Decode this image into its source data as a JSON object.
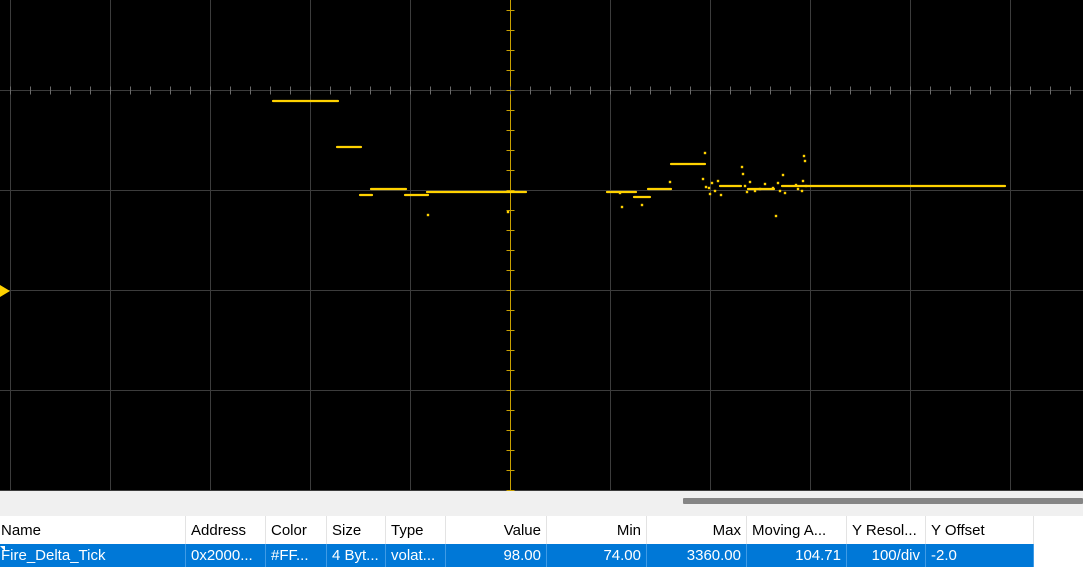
{
  "colors": {
    "background": "#000000",
    "grid": "#3c3c3c",
    "trace": "#ffd200",
    "cursor": "#c8a000",
    "selection": "#0078d7"
  },
  "icons": {
    "channel_marker": "triangle-right-icon"
  },
  "chart_data": {
    "type": "scatter",
    "grid": true,
    "xlim": [
      0,
      10.83
    ],
    "ylim": [
      -2.0,
      2.91
    ],
    "trigger_level": 0,
    "series": [
      {
        "segments": [
          [
            2.73,
            3.38,
            1.9
          ],
          [
            3.37,
            3.61,
            1.44
          ],
          [
            3.6,
            3.72,
            0.96
          ],
          [
            3.71,
            4.06,
            1.02
          ],
          [
            4.05,
            4.28,
            0.96
          ],
          [
            4.27,
            5.26,
            0.99
          ],
          [
            6.07,
            6.36,
            0.99
          ],
          [
            6.34,
            6.5,
            0.94
          ],
          [
            6.48,
            6.71,
            1.02
          ],
          [
            6.71,
            7.05,
            1.27
          ],
          [
            7.2,
            7.41,
            1.05
          ],
          [
            7.48,
            7.74,
            1.02
          ],
          [
            7.82,
            8.07,
            1.05
          ],
          [
            8.05,
            10.05,
            1.05
          ]
        ],
        "points": [
          [
            4.28,
            0.76
          ],
          [
            5.08,
            0.79
          ],
          [
            6.22,
            0.84
          ],
          [
            6.42,
            0.86
          ],
          [
            6.2,
            0.98
          ],
          [
            6.7,
            1.09
          ],
          [
            7.05,
            1.38
          ],
          [
            7.03,
            1.12
          ],
          [
            7.06,
            1.04
          ],
          [
            7.1,
            0.97
          ],
          [
            7.12,
            1.08
          ],
          [
            7.15,
            1.0
          ],
          [
            7.18,
            1.1
          ],
          [
            7.21,
            0.96
          ],
          [
            7.09,
            1.03
          ],
          [
            7.42,
            1.24
          ],
          [
            7.43,
            1.17
          ],
          [
            7.45,
            1.05
          ],
          [
            7.47,
            0.99
          ],
          [
            7.5,
            1.09
          ],
          [
            7.55,
            1.0
          ],
          [
            7.6,
            1.02
          ],
          [
            7.65,
            1.07
          ],
          [
            7.76,
            0.75
          ],
          [
            7.78,
            1.08
          ],
          [
            7.8,
            1.0
          ],
          [
            7.83,
            1.16
          ],
          [
            7.85,
            0.98
          ],
          [
            7.96,
            1.06
          ],
          [
            8.02,
            1.0
          ],
          [
            8.04,
            1.35
          ],
          [
            8.05,
            1.3
          ],
          [
            8.03,
            1.1
          ],
          [
            7.98,
            1.02
          ],
          [
            7.73,
            1.03
          ]
        ]
      }
    ]
  },
  "table": {
    "headers": [
      "Name",
      "Address",
      "Color",
      "Size",
      "Type",
      "Value",
      "Min",
      "Max",
      "Moving A...",
      "Y Resol...",
      "Y Offset"
    ],
    "row": {
      "name": "Fire_Delta_Tick",
      "address": "0x2000...",
      "color": "#FF...",
      "size": "4 Byt...",
      "type": "volat...",
      "value": "98.00",
      "min": "74.00",
      "max": "3360.00",
      "moving_avg": "104.71",
      "y_resolution": "100/div",
      "y_offset": "-2.0"
    }
  }
}
